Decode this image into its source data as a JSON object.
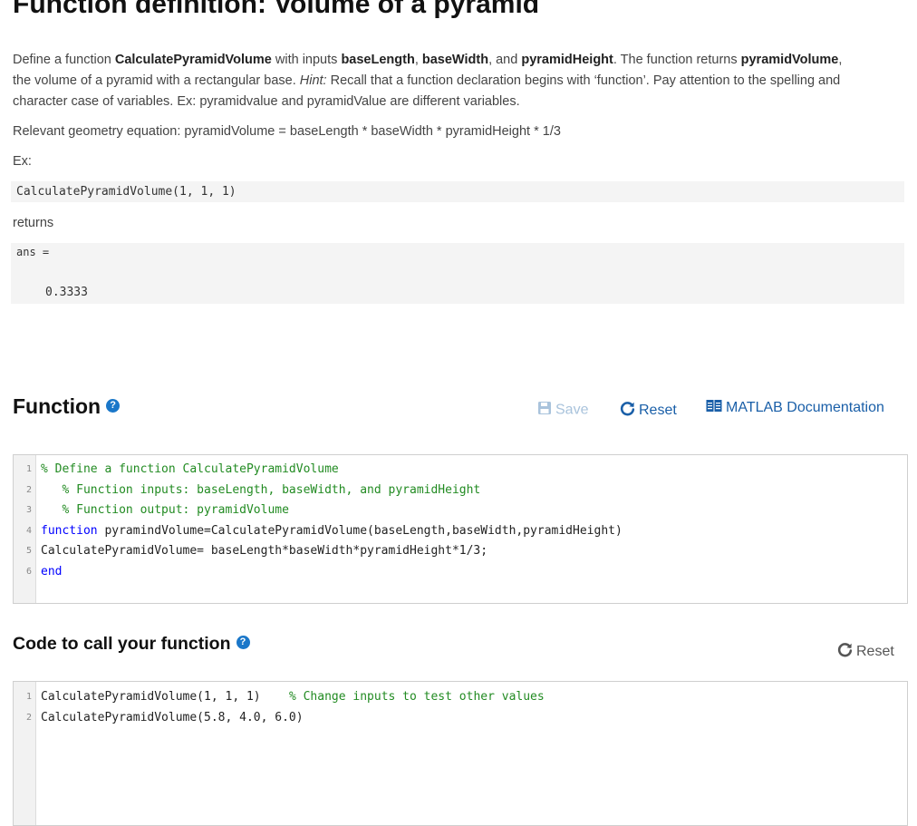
{
  "header": {
    "title": "Function definition: Volume of a pyramid"
  },
  "description": {
    "p1_a": "Define a function ",
    "p1_fn": "CalculatePyramidVolume",
    "p1_b": " with inputs ",
    "p1_in1": "baseLength",
    "p1_c": ", ",
    "p1_in2": "baseWidth",
    "p1_d": ", and ",
    "p1_in3": "pyramidHeight",
    "p1_e": ". The function returns ",
    "p1_out": "pyramidVolume",
    "p1_f": ", the volume of a pyramid with a rectangular base. ",
    "p1_hint": "Hint:",
    "p1_g": " Recall that a function declaration begins with ‘function’. Pay attention to the spelling and character case of variables. Ex: pyramidvalue and pyramidValue are different variables.",
    "equation": "Relevant geometry equation: pyramidVolume = baseLength * baseWidth * pyramidHeight * 1/3",
    "ex_label": "Ex:",
    "example_call": "CalculatePyramidVolume(1, 1, 1)",
    "returns_label": "returns",
    "output_ans": "ans =",
    "output_value": "0.3333"
  },
  "function_section": {
    "title": "Function",
    "help_icon": "?",
    "save_label": "Save",
    "reset_label": "Reset",
    "docs_label": "MATLAB Documentation",
    "lines": [
      {
        "num": "1",
        "parts": [
          {
            "t": "% Define a function CalculatePyramidVolume",
            "c": "cm"
          }
        ]
      },
      {
        "num": "2",
        "parts": [
          {
            "t": "   % Function inputs: baseLength, baseWidth, and pyramidHeight",
            "c": "cm"
          }
        ]
      },
      {
        "num": "3",
        "parts": [
          {
            "t": "   % Function output: pyramidVolume",
            "c": "cm"
          }
        ]
      },
      {
        "num": "4",
        "parts": [
          {
            "t": "function",
            "c": "kw"
          },
          {
            "t": " pyramindVolume=CalculatePyramidVolume(baseLength,baseWidth,pyramidHeight)",
            "c": "tx"
          }
        ]
      },
      {
        "num": "5",
        "parts": [
          {
            "t": "CalculatePyramidVolume= baseLength*baseWidth*pyramidHeight*1/3;",
            "c": "tx"
          }
        ]
      },
      {
        "num": "6",
        "parts": [
          {
            "t": "end",
            "c": "kw"
          }
        ]
      }
    ]
  },
  "call_section": {
    "title": "Code to call your function",
    "help_icon": "?",
    "reset_label": "Reset",
    "lines": [
      {
        "num": "1",
        "parts": [
          {
            "t": "CalculatePyramidVolume(1, 1, 1)",
            "c": "tx"
          },
          {
            "t": "    % Change inputs to test other values",
            "c": "cm"
          }
        ]
      },
      {
        "num": "2",
        "parts": [
          {
            "t": "CalculatePyramidVolume(5.8, 4.0, 6.0)",
            "c": "tx"
          }
        ]
      }
    ]
  },
  "icons": {
    "save": "floppy-disk-icon",
    "reset": "refresh-icon",
    "docs": "book-icon",
    "help": "question-circle-icon"
  },
  "colors": {
    "link": "#1a5fa8",
    "save_disabled": "#a9c3dc",
    "help_icon": "#1a77c9",
    "comment": "#228b22",
    "keyword": "#0000ff"
  }
}
